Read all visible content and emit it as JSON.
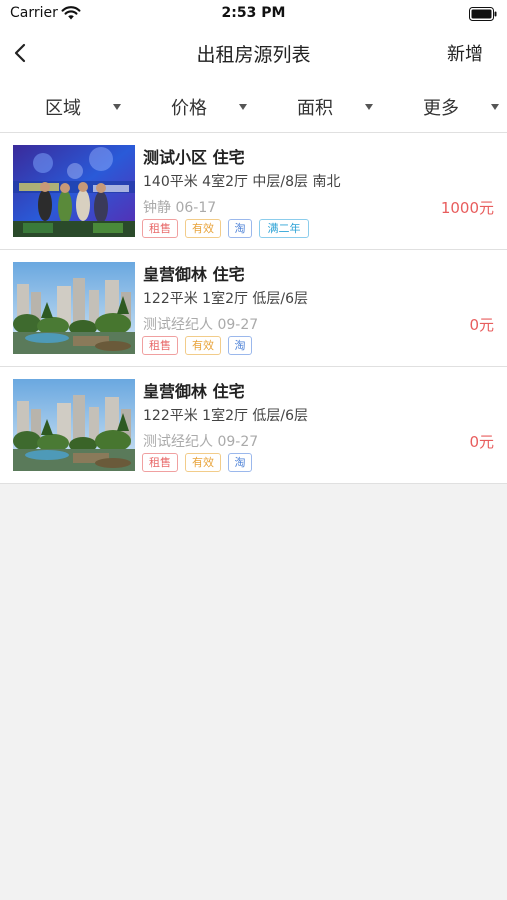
{
  "status_bar": {
    "carrier": "Carrier",
    "time": "2:53 PM"
  },
  "nav": {
    "title": "出租房源列表",
    "add_label": "新增"
  },
  "filters": [
    {
      "label": "区域"
    },
    {
      "label": "价格"
    },
    {
      "label": "面积"
    },
    {
      "label": "更多"
    }
  ],
  "listings": [
    {
      "title": "测试小区 住宅",
      "info": "140平米 4室2厅 中层/8层 南北",
      "agent_date": "钟静 06-17",
      "price": "1000元",
      "tags": [
        "租售",
        "有效",
        "淘",
        "满二年"
      ],
      "image": "event-photo"
    },
    {
      "title": "皇营御林 住宅",
      "info": "122平米 1室2厅 低层/6层",
      "agent_date": "测试经纪人 09-27",
      "price": "0元",
      "tags": [
        "租售",
        "有效",
        "淘"
      ],
      "image": "estate-photo"
    },
    {
      "title": "皇营御林 住宅",
      "info": "122平米 1室2厅 低层/6层",
      "agent_date": "测试经纪人 09-27",
      "price": "0元",
      "tags": [
        "租售",
        "有效",
        "淘"
      ],
      "image": "estate-photo"
    }
  ],
  "colors": {
    "price": "#e85d5d",
    "tag_rent": "#e86a6a",
    "tag_valid": "#e8a33a",
    "tag_tao": "#4a7fd6",
    "tag_two_years": "#2ea3d6",
    "background": "#f2f2f2"
  }
}
